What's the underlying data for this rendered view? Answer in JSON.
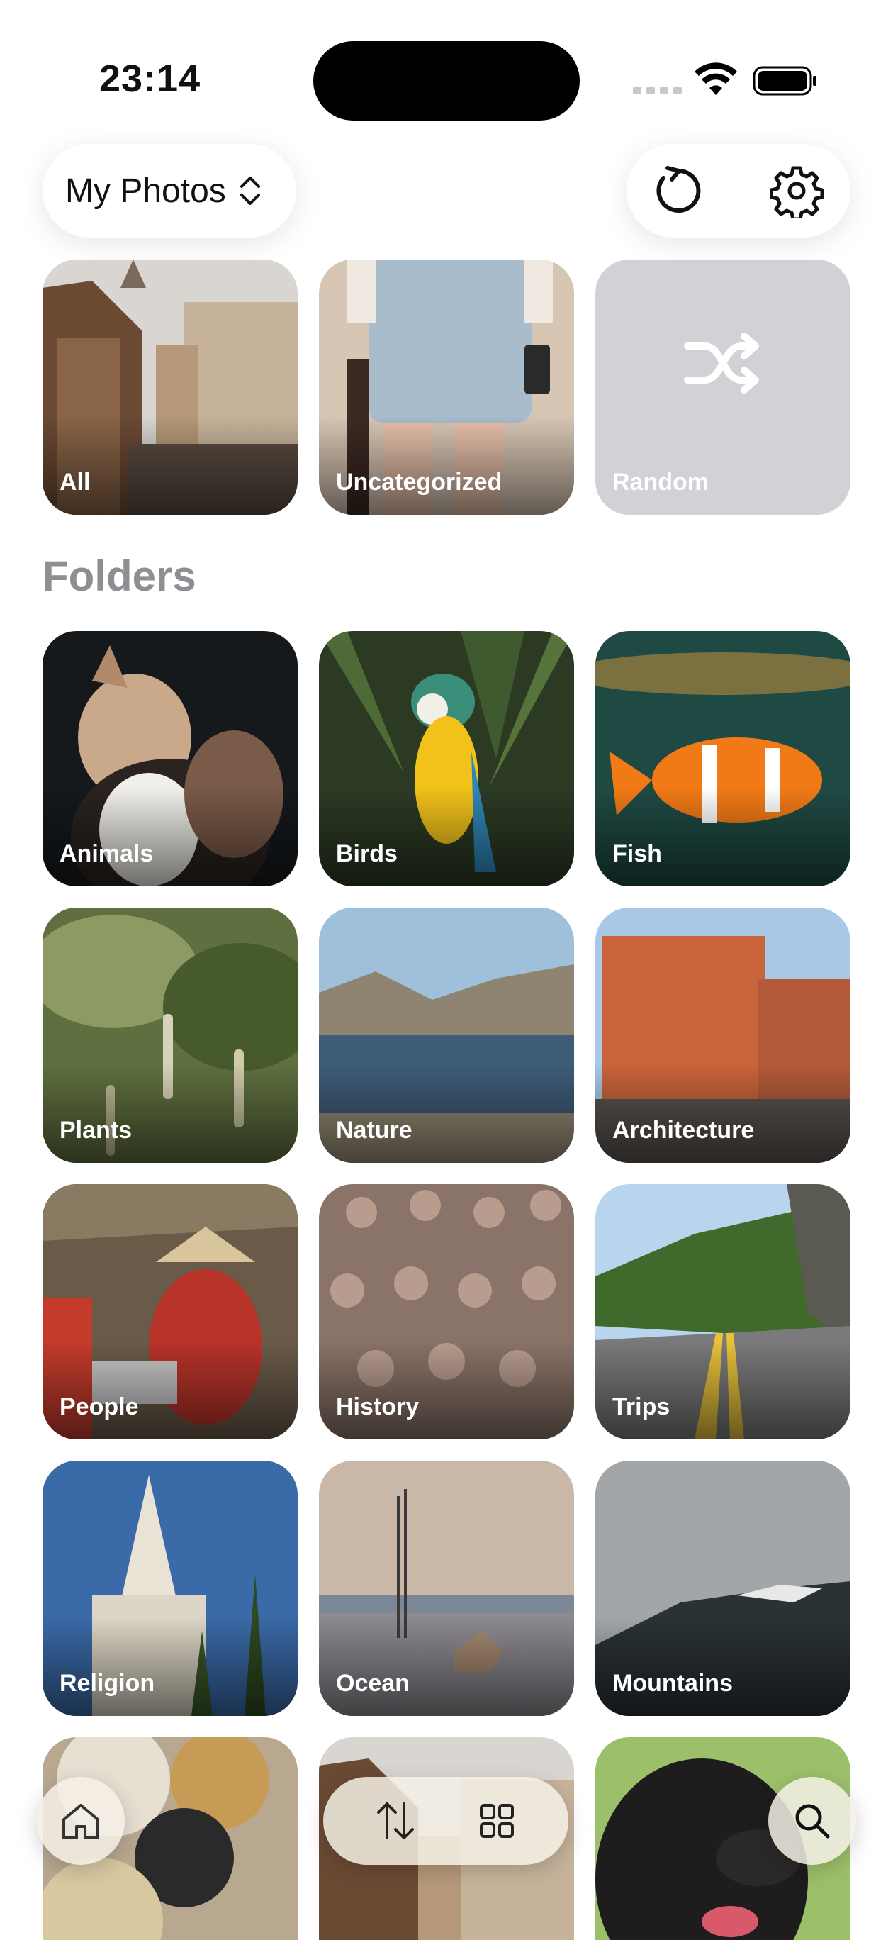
{
  "status": {
    "time": "23:14"
  },
  "header": {
    "album_label": "My Photos"
  },
  "quick": [
    {
      "label": "All"
    },
    {
      "label": "Uncategorized"
    },
    {
      "label": "Random"
    }
  ],
  "folders_title": "Folders",
  "folders": [
    {
      "label": "Animals"
    },
    {
      "label": "Birds"
    },
    {
      "label": "Fish"
    },
    {
      "label": "Plants"
    },
    {
      "label": "Nature"
    },
    {
      "label": "Architecture"
    },
    {
      "label": "People"
    },
    {
      "label": "History"
    },
    {
      "label": "Trips"
    },
    {
      "label": "Religion"
    },
    {
      "label": "Ocean"
    },
    {
      "label": "Mountains"
    }
  ],
  "icons": [
    "chevron-updown-icon",
    "refresh-icon",
    "gear-icon",
    "shuffle-icon",
    "home-icon",
    "sort-icon",
    "grid-icon",
    "search-icon"
  ],
  "colors": {
    "section_title": "#8e8e93",
    "random_tile": "#d1d1d6"
  }
}
